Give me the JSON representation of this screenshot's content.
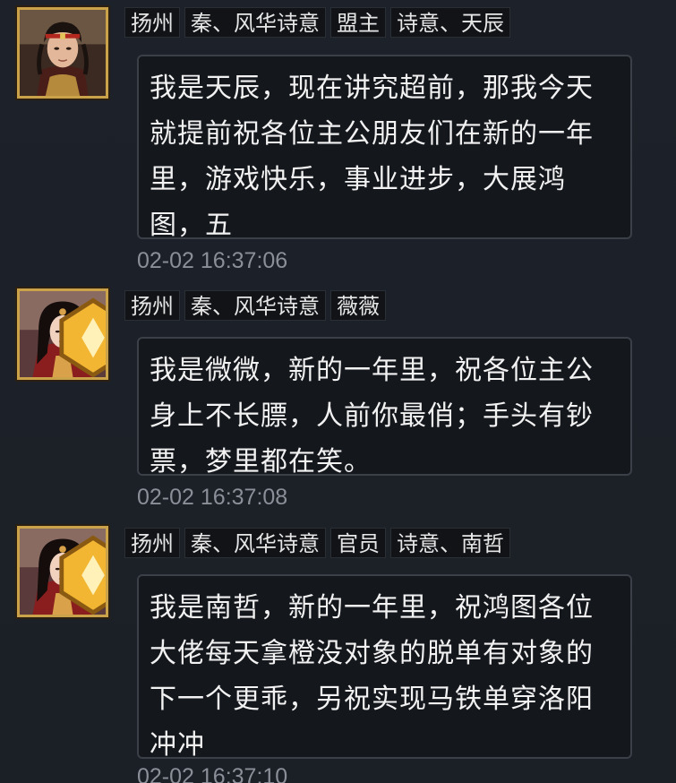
{
  "messages": [
    {
      "avatar": "male-general-avatar",
      "tags": [
        "扬州",
        "秦、风华诗意",
        "盟主",
        "诗意、天辰"
      ],
      "text": "我是天辰，现在讲究超前，那我今天就提前祝各位主公朋友们在新的一年里，游戏快乐，事业进步，大展鸿图，五",
      "time": "02-02 16:37:06"
    },
    {
      "avatar": "female-avatar",
      "tags": [
        "扬州",
        "秦、风华诗意",
        "薇薇"
      ],
      "text": "我是微微，新的一年里，祝各位主公身上不长膘，人前你最俏；手头有钞票，梦里都在笑。",
      "time": "02-02 16:37:08"
    },
    {
      "avatar": "female-avatar",
      "tags": [
        "扬州",
        "秦、风华诗意",
        "官员",
        "诗意、南哲"
      ],
      "text": "我是南哲，新的一年里，祝鸿图各位大佬每天拿橙没对象的脱单有对象的下一个更乖，另祝实现马铁单穿洛阳冲冲",
      "time": "02-02 16:37:10"
    }
  ],
  "colors": {
    "background": "#1c2027",
    "bubble": "#14171c",
    "bubble_border": "#3a3f48",
    "tag_bg": "#111317",
    "text": "#f2f2f2",
    "timestamp": "#8a8f98",
    "frame_gold": "#c9a24a"
  }
}
